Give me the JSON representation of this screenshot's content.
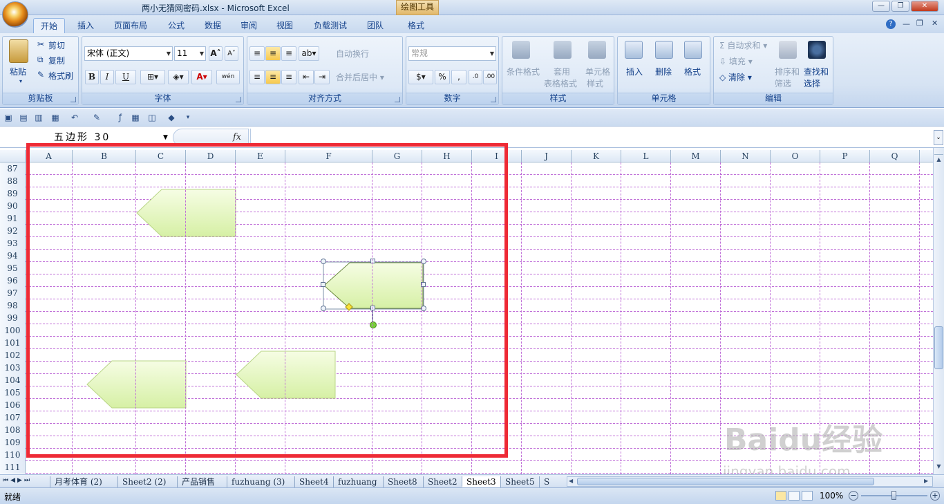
{
  "window": {
    "title": "两小无猜网密码.xlsx - Microsoft Excel",
    "context_tool": "绘图工具"
  },
  "tabs": [
    "开始",
    "插入",
    "页面布局",
    "公式",
    "数据",
    "审阅",
    "视图",
    "负载测试",
    "团队",
    "格式"
  ],
  "ribbon": {
    "clipboard": {
      "paste": "粘贴",
      "cut": "剪切",
      "copy": "复制",
      "format_painter": "格式刷",
      "label": "剪贴板"
    },
    "font": {
      "name": "宋体 (正文)",
      "size": "11",
      "grow": "A",
      "shrink": "A",
      "bold": "B",
      "italic": "I",
      "underline": "U",
      "color_letter": "A",
      "wen": "wén",
      "label": "字体"
    },
    "alignment": {
      "wrap": "自动换行",
      "merge": "合并后居中",
      "label": "对齐方式"
    },
    "number": {
      "format": "常规",
      "percent": "%",
      "comma": ",",
      "label": "数字"
    },
    "styles": {
      "conditional": "条件格式",
      "table_format_1": "套用",
      "table_format_2": "表格格式",
      "cell_style_1": "单元格",
      "cell_style_2": "样式",
      "label": "样式"
    },
    "cells": {
      "insert": "插入",
      "delete": "删除",
      "format": "格式",
      "label": "单元格"
    },
    "editing": {
      "autosum": "自动求和",
      "fill": "填充",
      "clear": "清除",
      "sort_1": "排序和",
      "sort_2": "筛选",
      "find_1": "查找和",
      "find_2": "选择",
      "sigma": "Σ",
      "label": "编辑"
    }
  },
  "formula_bar": {
    "name_box": "五边形 30",
    "fx": "fx",
    "value": ""
  },
  "columns": [
    "A",
    "B",
    "C",
    "D",
    "E",
    "F",
    "G",
    "H",
    "I",
    "J",
    "K",
    "L",
    "M",
    "N",
    "O",
    "P",
    "Q"
  ],
  "rows": [
    "87",
    "88",
    "89",
    "90",
    "91",
    "92",
    "93",
    "94",
    "95",
    "96",
    "97",
    "98",
    "99",
    "100",
    "101",
    "102",
    "103",
    "104",
    "105",
    "106",
    "107",
    "108",
    "109",
    "110",
    "111"
  ],
  "sheets": [
    "月考体育 (2)",
    "Sheet2 (2)",
    "产品销售",
    "fuzhuang (3)",
    "Sheet4",
    "fuzhuang",
    "Sheet8",
    "Sheet2",
    "Sheet3",
    "Sheet5",
    "S"
  ],
  "active_sheet": "Sheet3",
  "status": {
    "ready": "就绪",
    "zoom": "100%"
  },
  "watermark": {
    "logo": "Baidu经验",
    "url": "jingyan.baidu.com"
  },
  "colors": {
    "highlight": "#ee2a35",
    "shape_fill": "#e6f7c2",
    "gridline": "#c070d8"
  }
}
